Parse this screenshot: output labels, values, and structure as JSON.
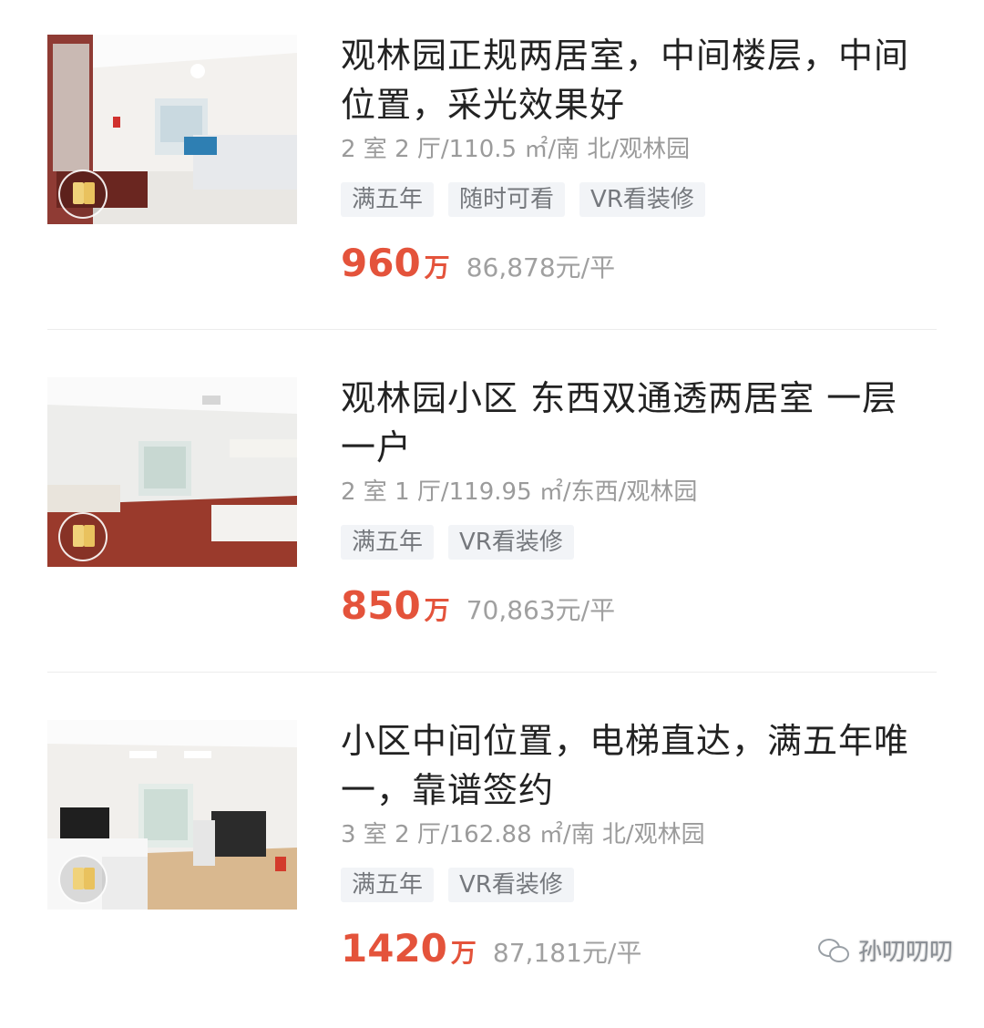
{
  "listings": [
    {
      "title": "观林园正规两居室，中间楼层，中间位置，采光效果好",
      "meta": "2 室 2 厅/110.5 ㎡/南 北/观林园",
      "tags": [
        "满五年",
        "随时可看",
        "VR看装修"
      ],
      "price": "960",
      "price_unit": "万",
      "unit_price": "86,878元/平"
    },
    {
      "title": "观林园小区 东西双通透两居室 一层一户",
      "meta": "2 室 1 厅/119.95 ㎡/东西/观林园",
      "tags": [
        "满五年",
        "VR看装修"
      ],
      "price": "850",
      "price_unit": "万",
      "unit_price": "70,863元/平"
    },
    {
      "title": "小区中间位置，电梯直达，满五年唯一，靠谱签约",
      "meta": "3 室 2 厅/162.88 ㎡/南 北/观林园",
      "tags": [
        "满五年",
        "VR看装修"
      ],
      "price": "1420",
      "price_unit": "万",
      "unit_price": "87,181元/平"
    }
  ],
  "watermark": {
    "text": "孙叨叨叨"
  },
  "colors": {
    "price": "#e4533b",
    "tag_bg": "#f2f4f7",
    "meta": "#9b9b9b"
  }
}
